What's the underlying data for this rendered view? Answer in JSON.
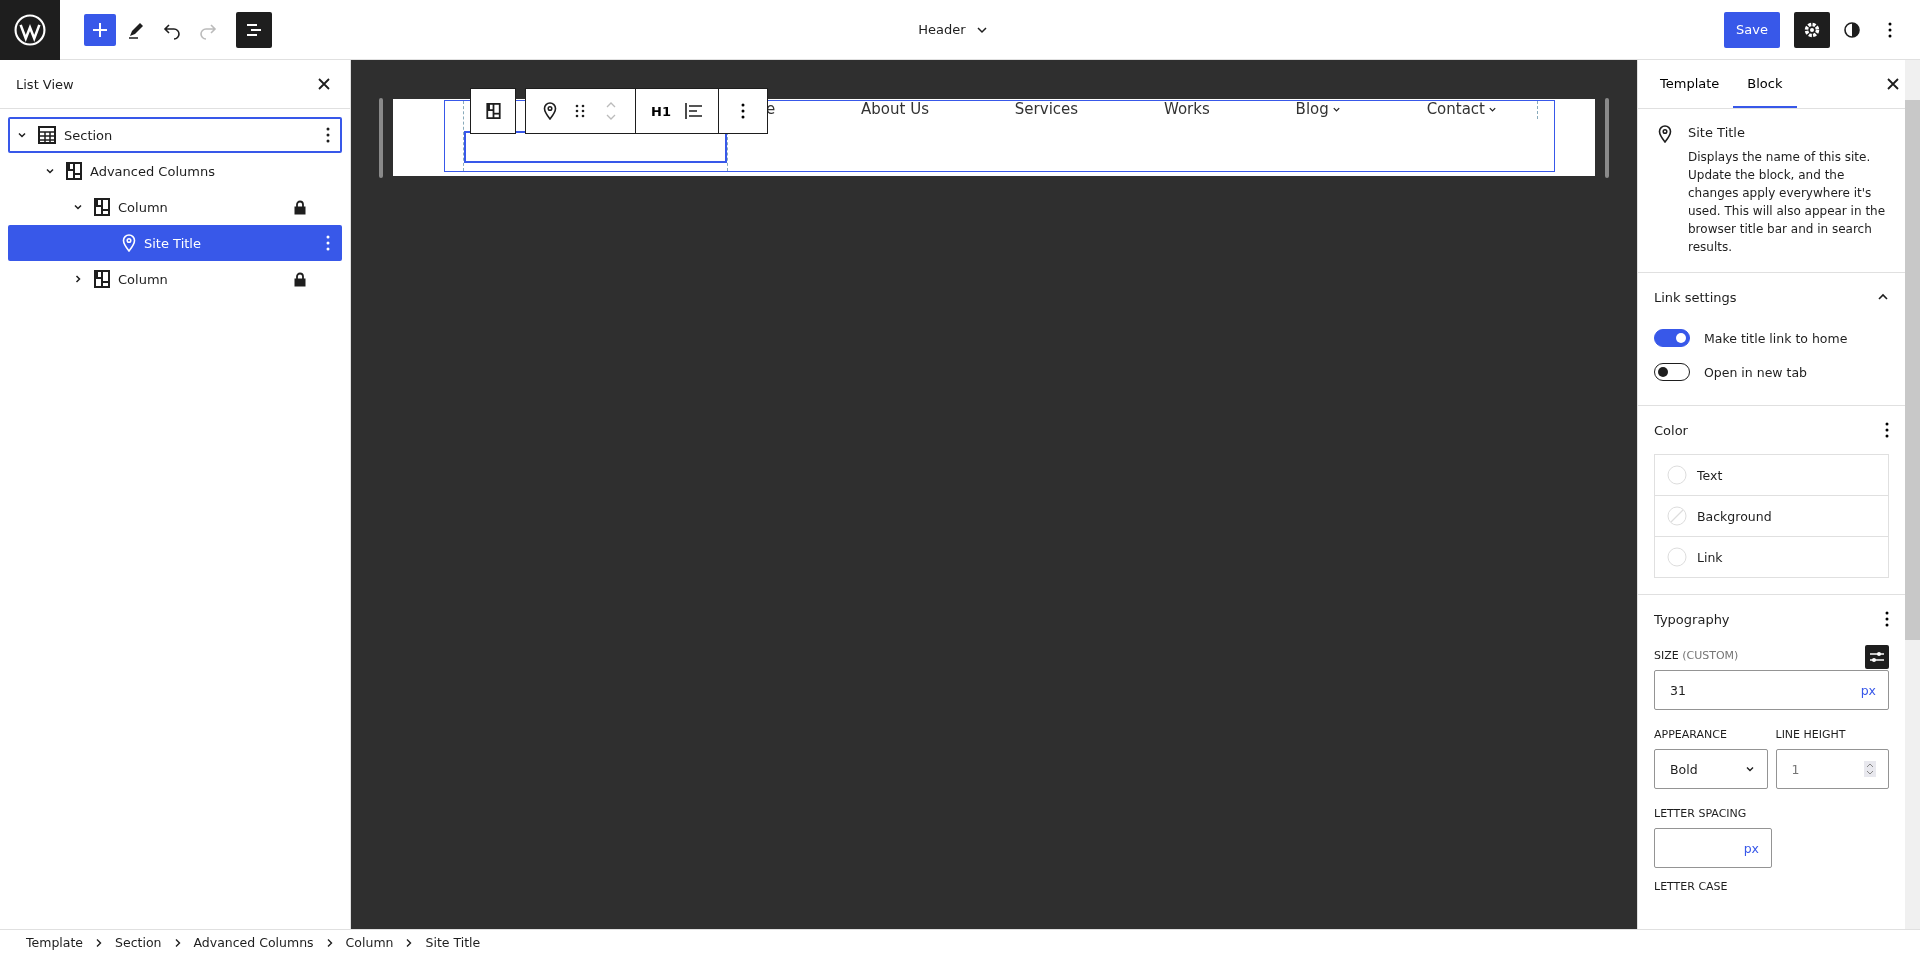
{
  "top_bar": {
    "title": "Header",
    "save_label": "Save",
    "redo_disabled": true
  },
  "list_view": {
    "title": "List View",
    "items": [
      {
        "label": "Section",
        "kind": "section",
        "expanded": true,
        "locked": false,
        "selected": false,
        "focused": true,
        "children": [
          {
            "label": "Advanced Columns",
            "kind": "columns",
            "expanded": true,
            "locked": false,
            "selected": false,
            "focused": false,
            "children": [
              {
                "label": "Column",
                "kind": "columns",
                "expanded": true,
                "locked": true,
                "selected": false,
                "focused": false,
                "children": [
                  {
                    "label": "Site Title",
                    "kind": "site-title",
                    "locked": false,
                    "selected": true,
                    "focused": false
                  }
                ]
              },
              {
                "label": "Column",
                "kind": "columns",
                "expanded": false,
                "locked": true,
                "selected": false,
                "focused": false
              }
            ]
          }
        ]
      }
    ]
  },
  "canvas": {
    "toolbar": {
      "heading_level": "H1"
    },
    "nav_items": [
      {
        "label": "e",
        "submenu": false
      },
      {
        "label": "About Us",
        "submenu": false
      },
      {
        "label": "Services",
        "submenu": false
      },
      {
        "label": "Works",
        "submenu": false
      },
      {
        "label": "Blog",
        "submenu": true
      },
      {
        "label": "Contact",
        "submenu": true
      }
    ]
  },
  "inspector": {
    "tabs": [
      {
        "label": "Template",
        "selected": false
      },
      {
        "label": "Block",
        "selected": true
      }
    ],
    "block": {
      "name": "Site Title",
      "description": "Displays the name of this site. Update the block, and the changes apply everywhere it's used. This will also appear in the browser title bar and in search results."
    },
    "link_settings": {
      "title": "Link settings",
      "expanded": true,
      "toggles": [
        {
          "label": "Make title link to home",
          "on": true
        },
        {
          "label": "Open in new tab",
          "on": false
        }
      ]
    },
    "color": {
      "title": "Color",
      "items": [
        {
          "label": "Text",
          "kind": "empty"
        },
        {
          "label": "Background",
          "kind": "slashed"
        },
        {
          "label": "Link",
          "kind": "empty"
        }
      ]
    },
    "typography": {
      "title": "Typography",
      "size_label": "SIZE",
      "size_note": "(CUSTOM)",
      "size_value": "31",
      "size_unit": "px",
      "appearance_label": "APPEARANCE",
      "appearance_value": "Bold",
      "line_height_label": "LINE HEIGHT",
      "line_height_value": "1",
      "letter_spacing_label": "LETTER SPACING",
      "letter_spacing_unit": "px",
      "letter_case_label": "LETTER CASE"
    }
  },
  "breadcrumb": [
    "Template",
    "Section",
    "Advanced Columns",
    "Column",
    "Site Title"
  ]
}
